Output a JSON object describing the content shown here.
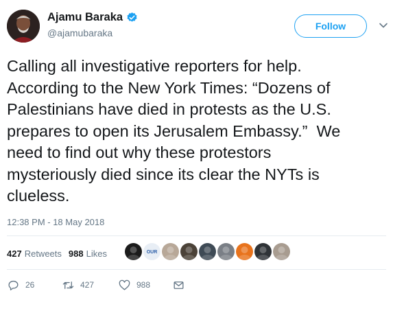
{
  "author": {
    "name": "Ajamu Baraka",
    "handle": "@ajamubaraka",
    "verified": true
  },
  "follow_label": "Follow",
  "tweet": {
    "text": "Calling all investigative reporters for help.\nAccording to the New York Times: “Dozens of\nPalestinians have died in protests as the U.S.\nprepares to open its Jerusalem Embassy.”  We\nneed to find out why these protestors\nmysteriously died since its clear the NYTs is\nclueless.",
    "timestamp": "12:38 PM - 18 May 2018"
  },
  "stats": {
    "retweets_count": "427",
    "retweets_label": "Retweets",
    "likes_count": "988",
    "likes_label": "Likes"
  },
  "liker_avatars": [
    {
      "name": "liker-avatar",
      "color": "#1b1b1b"
    },
    {
      "name": "liker-avatar",
      "color": "#e8eef5",
      "logo_text": "OUR"
    },
    {
      "name": "liker-avatar",
      "color": "#b8a898"
    },
    {
      "name": "liker-avatar",
      "color": "#4b4238"
    },
    {
      "name": "liker-avatar",
      "color": "#3e4a55"
    },
    {
      "name": "liker-avatar",
      "color": "#7a7f86"
    },
    {
      "name": "liker-avatar",
      "color": "#e8731c"
    },
    {
      "name": "liker-avatar",
      "color": "#2f3337"
    },
    {
      "name": "liker-avatar",
      "color": "#a89c90"
    }
  ],
  "actions": {
    "reply_count": "26",
    "retweet_count": "427",
    "like_count": "988"
  },
  "colors": {
    "accent": "#1da1f2",
    "muted": "#657786",
    "text": "#14171a",
    "divider": "#e6ecf0"
  }
}
